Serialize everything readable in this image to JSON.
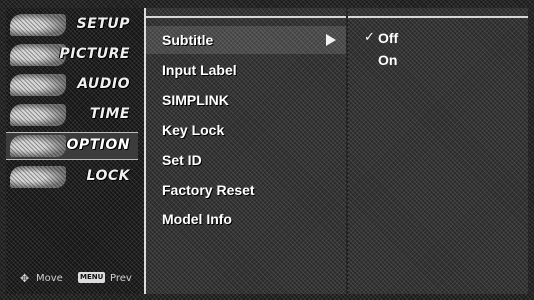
{
  "sidebar": {
    "items": [
      {
        "label": "SETUP",
        "icon": "setup-icon"
      },
      {
        "label": "PICTURE",
        "icon": "picture-icon"
      },
      {
        "label": "AUDIO",
        "icon": "audio-icon"
      },
      {
        "label": "TIME",
        "icon": "time-icon"
      },
      {
        "label": "OPTION",
        "icon": "option-icon",
        "active": true
      },
      {
        "label": "LOCK",
        "icon": "lock-icon"
      }
    ],
    "footer": {
      "move_label": "Move",
      "menu_key": "MENU",
      "prev_label": "Prev"
    }
  },
  "menu": {
    "items": [
      {
        "label": "Subtitle",
        "selected": true,
        "has_submenu": true
      },
      {
        "label": "Input Label"
      },
      {
        "label": "SIMPLINK"
      },
      {
        "label": "Key Lock"
      },
      {
        "label": "Set ID"
      },
      {
        "label": "Factory Reset"
      },
      {
        "label": "Model Info"
      }
    ]
  },
  "submenu": {
    "items": [
      {
        "label": "Off",
        "checked": true
      },
      {
        "label": "On",
        "checked": false
      }
    ]
  },
  "colors": {
    "background": "#2a2a2a",
    "text": "#ffffff",
    "divider": "#d6d6d6"
  }
}
